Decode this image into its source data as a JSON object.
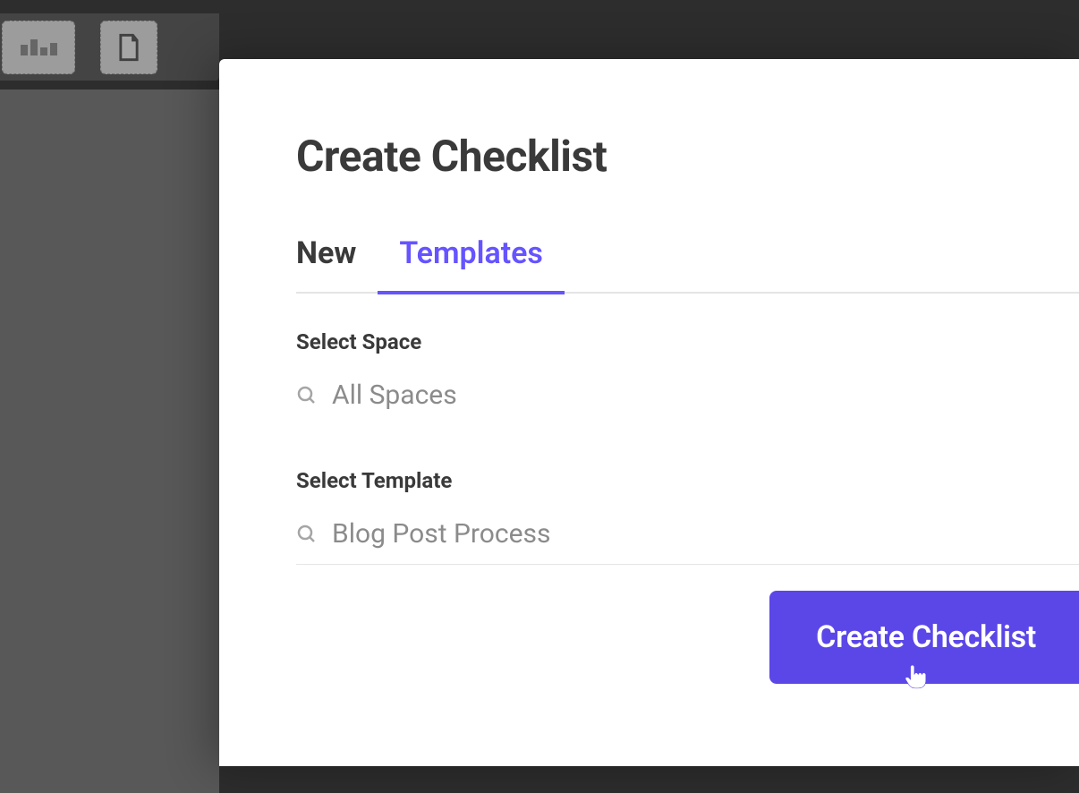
{
  "modal": {
    "title": "Create Checklist",
    "tabs": {
      "new": "New",
      "templates": "Templates",
      "active": "templates"
    },
    "spaceField": {
      "label": "Select Space",
      "value": "All Spaces"
    },
    "templateField": {
      "label": "Select Template",
      "value": "Blog Post Process"
    },
    "primaryButton": "Create Checklist"
  },
  "icons": {
    "search": "search-icon",
    "cursor": "hand-pointer-icon"
  },
  "colors": {
    "accent": "#5b47e8",
    "tabActive": "#6554ff",
    "textDark": "#3a3a3a",
    "textMuted": "#8b8b8b"
  }
}
